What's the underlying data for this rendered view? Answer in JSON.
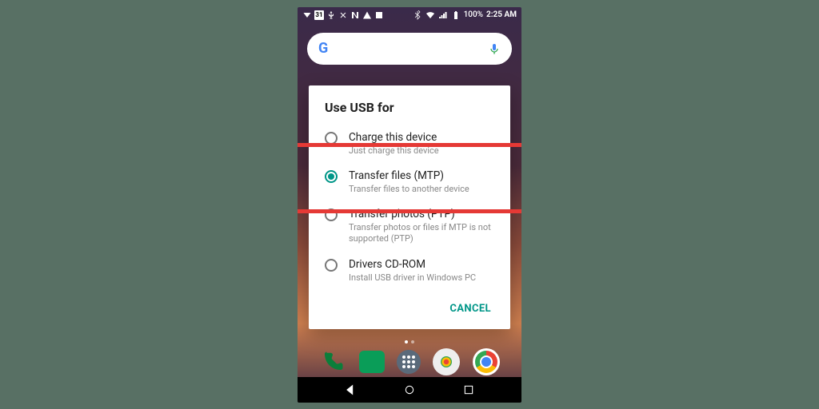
{
  "status": {
    "date": "31",
    "battery_pct": "100%",
    "time": "2:25 AM"
  },
  "search": {
    "mic_label": "voice-search"
  },
  "dialog": {
    "title": "Use USB for",
    "options": [
      {
        "title": "Charge this device",
        "subtitle": "Just charge this device",
        "selected": false
      },
      {
        "title": "Transfer files (MTP)",
        "subtitle": "Transfer files to another device",
        "selected": true
      },
      {
        "title": "Transfer photos (PTP)",
        "subtitle": "Transfer photos or files if MTP is not supported (PTP)",
        "selected": false
      },
      {
        "title": "Drivers CD-ROM",
        "subtitle": "Install USB driver in Windows PC",
        "selected": false
      }
    ],
    "cancel": "CANCEL"
  },
  "highlight_option_index": 1
}
